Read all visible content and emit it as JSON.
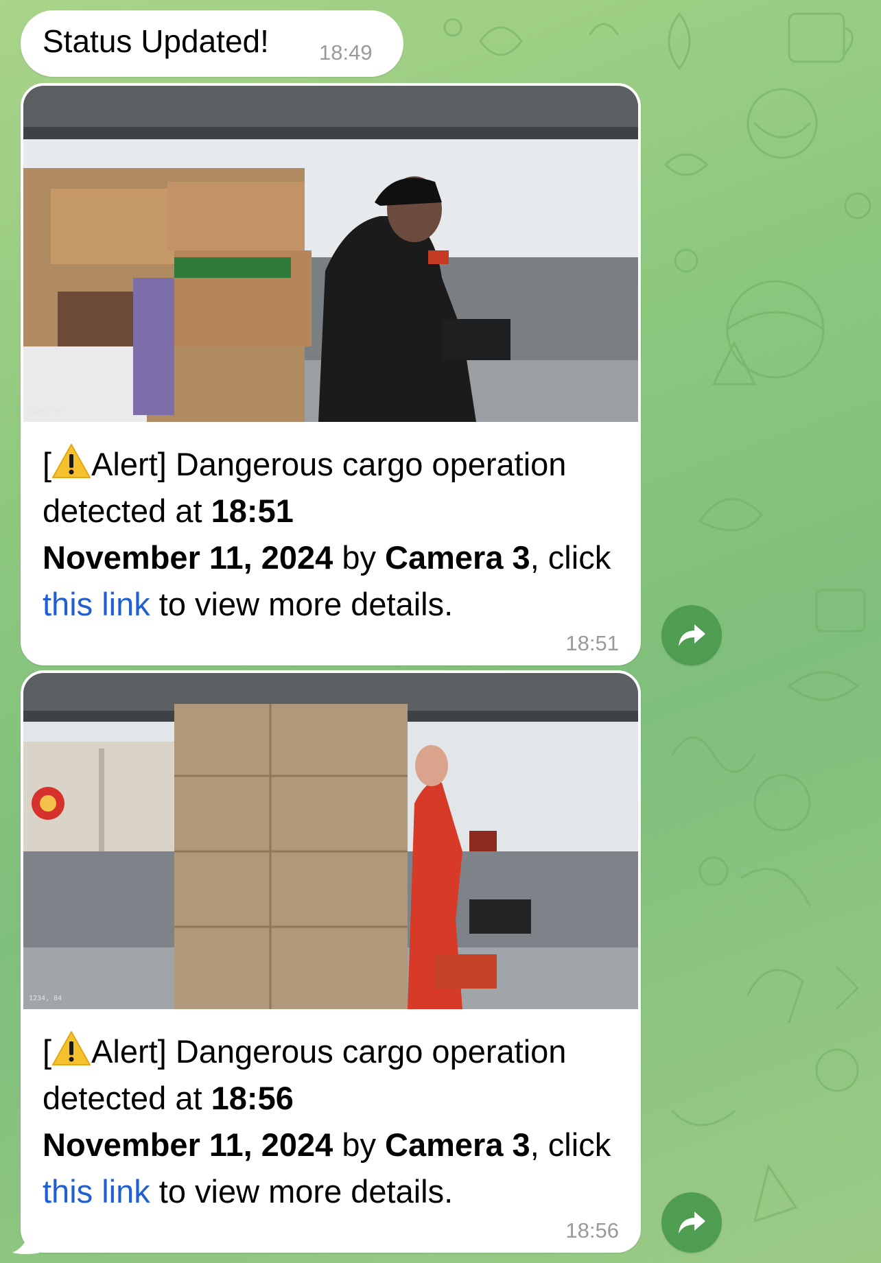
{
  "status_message": {
    "text": "Status Updated!",
    "time": "18:49"
  },
  "alerts": [
    {
      "prefix": "[",
      "label": "Alert] Dangerous cargo operation detected at ",
      "time_bold": "18:51",
      "date_bold": "November 11, 2024",
      "by_text": " by ",
      "camera_bold": "Camera 3",
      "click_text": ", click ",
      "link_text": "this link",
      "suffix": " to view more details.",
      "timestamp": "18:51",
      "overlay_text": "1234, 84",
      "icon": "warning-icon"
    },
    {
      "prefix": "[",
      "label": "Alert] Dangerous cargo operation detected at ",
      "time_bold": "18:56",
      "date_bold": "November 11, 2024",
      "by_text": " by ",
      "camera_bold": "Camera 3",
      "click_text": ", click ",
      "link_text": "this link",
      "suffix": " to view more details.",
      "timestamp": "18:56",
      "overlay_text": "1234, 84",
      "icon": "warning-icon"
    }
  ],
  "share_button_icon": "forward-arrow-icon",
  "colors": {
    "bubble": "#ffffff",
    "link": "#1f5fd1",
    "timestamp": "#9a9a9a",
    "share_button": "#4f9d50",
    "chat_background": "#8cc77e"
  }
}
